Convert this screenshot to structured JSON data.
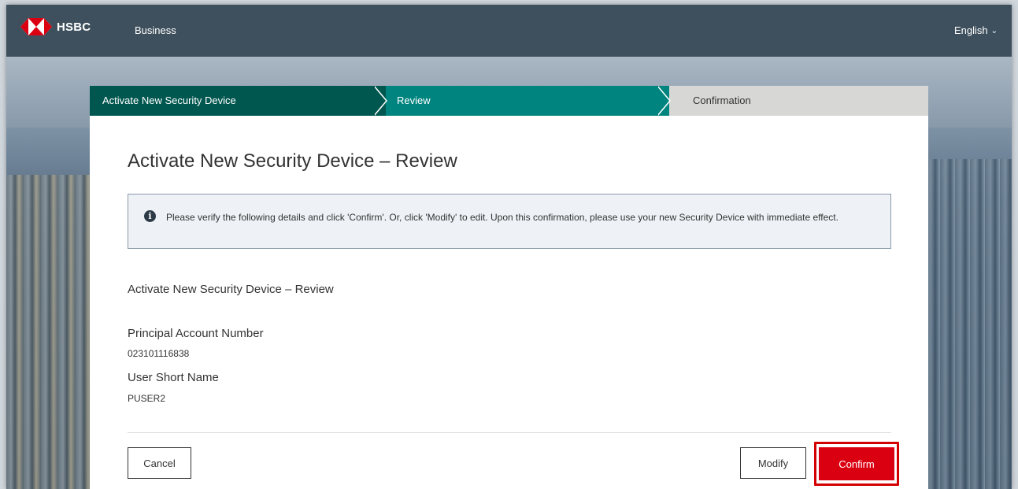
{
  "header": {
    "logo_text": "HSBC",
    "nav_business": "Business",
    "language": "English"
  },
  "steps": [
    {
      "label": "Activate New Security Device",
      "state": "completed"
    },
    {
      "label": "Review",
      "state": "current"
    },
    {
      "label": "Confirmation",
      "state": "upcoming"
    }
  ],
  "page_title": "Activate New Security Device – Review",
  "info_message": "Please verify the following details and click 'Confirm'. Or, click 'Modify' to edit. Upon this confirmation, please use your new Security Device with immediate effect.",
  "section_title": "Activate New Security Device – Review",
  "fields": [
    {
      "label": "Principal Account Number",
      "value": "023101116838"
    },
    {
      "label": "User Short Name",
      "value": "PUSER2"
    }
  ],
  "buttons": {
    "cancel": "Cancel",
    "modify": "Modify",
    "confirm": "Confirm"
  },
  "colors": {
    "brand_red": "#db0011",
    "header_bg": "#3e505d",
    "step_completed": "#00574f",
    "step_current": "#00847f",
    "step_upcoming": "#d7d8d6"
  },
  "icons": {
    "logo": "hsbc-hexagon-logo",
    "info": "info-icon",
    "language_chevron": "chevron-down-icon",
    "step_arrow": "chevron-right-icon"
  }
}
